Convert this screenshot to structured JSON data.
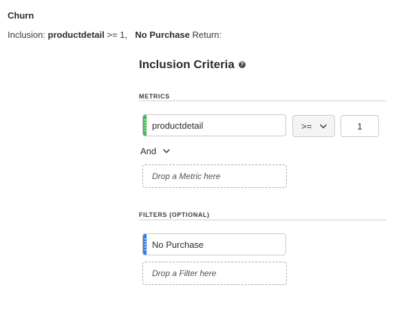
{
  "segment": {
    "title": "Churn",
    "summary": {
      "inclusion_label": "Inclusion:",
      "metric_name": "productdetail",
      "condition": ">= 1,",
      "filter_name": "No Purchase",
      "return_label": "Return:"
    }
  },
  "inclusion_criteria": {
    "title": "Inclusion Criteria",
    "help_icon": "help-circle-icon",
    "metrics": {
      "label": "METRICS",
      "item": {
        "name": "productdetail",
        "color": "#44b556",
        "operator": ">=",
        "value": "1"
      },
      "combinator": "And",
      "drop_placeholder": "Drop a Metric here"
    },
    "filters": {
      "label": "FILTERS (OPTIONAL)",
      "item": {
        "name": "No Purchase",
        "color": "#2d7be5"
      },
      "drop_placeholder": "Drop a Filter here"
    }
  }
}
